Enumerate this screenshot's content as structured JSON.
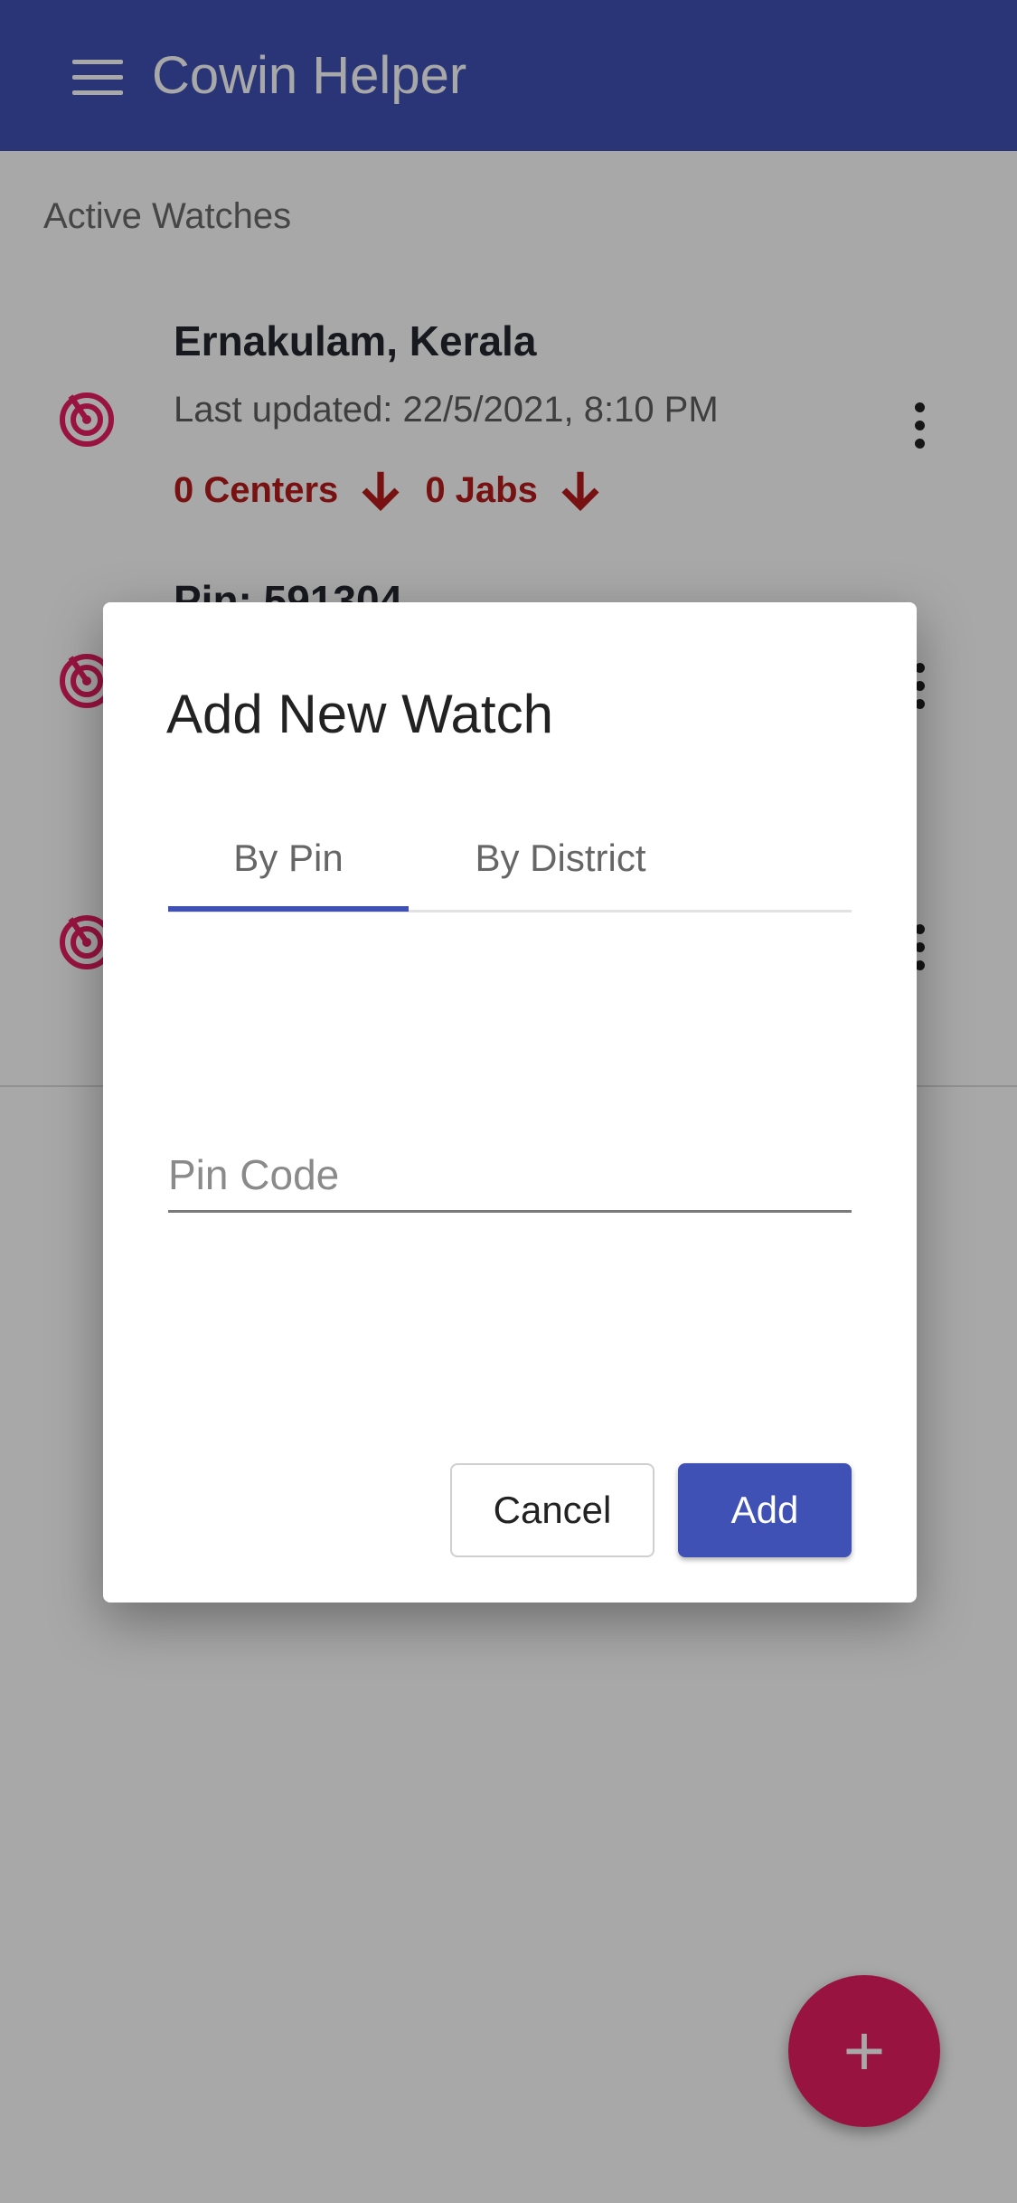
{
  "app": {
    "title": "Cowin Helper"
  },
  "colors": {
    "primary": "#3f51b5",
    "accent": "#e91e63",
    "alert": "#b71c1c"
  },
  "icons": {
    "menu": "hamburger-menu-icon",
    "watch": "radar-target-icon",
    "more": "more-vertical-icon",
    "arrow": "arrow-down-icon",
    "fab": "plus-icon"
  },
  "section": {
    "title": "Active Watches"
  },
  "watches": [
    {
      "title": "Ernakulam, Kerala",
      "updated": "Last updated: 22/5/2021, 8:10 PM",
      "centers": "0 Centers",
      "jabs": "0 Jabs"
    },
    {
      "title": "Pin: 591304"
    }
  ],
  "fab": {
    "label": "+"
  },
  "dialog": {
    "title": "Add New Watch",
    "tabs": [
      {
        "label": "By Pin",
        "selected": true
      },
      {
        "label": "By District",
        "selected": false
      }
    ],
    "pin_placeholder": "Pin Code",
    "pin_value": "",
    "cancel_label": "Cancel",
    "add_label": "Add"
  }
}
